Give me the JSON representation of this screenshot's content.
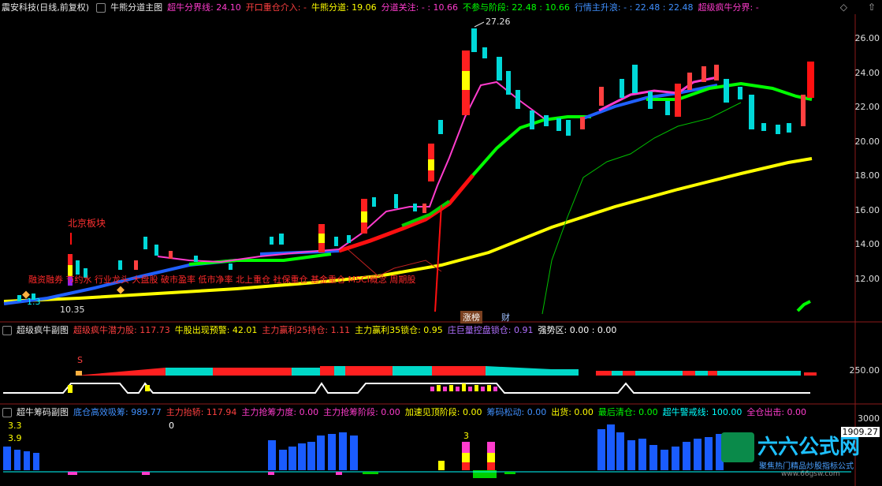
{
  "main": {
    "title": "震安科技(日线,前复权)",
    "indicator": "牛熊分道主图",
    "values": [
      {
        "label": "超牛分界线: 24.10",
        "color": "#ff3ccd"
      },
      {
        "label": "开口重仓介入: -",
        "color": "#ff4040"
      },
      {
        "label": "牛熊分道: 19.06",
        "color": "#ffff00"
      },
      {
        "label": "分道关注: - : 10.66",
        "color": "#ff3ccd"
      },
      {
        "label": "不参与阶段: 22.48 : 10.66",
        "color": "#00ff00"
      },
      {
        "label": "行情主升浪: - : 22.48 : 22.48",
        "color": "#4090ff"
      },
      {
        "label": "超级疯牛分界: -",
        "color": "#ff3ccd"
      }
    ],
    "y_ticks": [
      "26.00",
      "24.00",
      "22.00",
      "20.00",
      "18.00",
      "16.00",
      "14.00",
      "12.00"
    ],
    "annotations": {
      "peak": "27.26",
      "low": "10.35",
      "beijing": "北京板块",
      "concept": "融资融券 节约水 行业龙头 大盘股 破市盈率 低市净率 北上重仓 社保重仓 基金重仓 MSCI概念 周期股",
      "n13": "1.3",
      "zhangbang": "涨榜",
      "cai": "财"
    }
  },
  "sub1": {
    "indicator": "超级疯牛副图",
    "values": [
      {
        "label": "超级疯牛潜力股: 117.73",
        "color": "#ff4040"
      },
      {
        "label": "牛股出现预警: 42.01",
        "color": "#ffff00"
      },
      {
        "label": "主力赢利25持仓: 1.11",
        "color": "#ff4040"
      },
      {
        "label": "主力赢利35锁仓: 0.95",
        "color": "#ffff00"
      },
      {
        "label": "庄巨量控盘锁仓: 0.91",
        "color": "#b070ff"
      },
      {
        "label": "强势区: 0.00 : 0.00",
        "color": "#ffffff"
      }
    ],
    "y_tick": "250.00",
    "s_mark": "S"
  },
  "sub2": {
    "indicator": "超牛筹码副图",
    "values": [
      {
        "label": "底仓高效吸筹: 989.77",
        "color": "#4090ff"
      },
      {
        "label": "主力抬轿: 117.94",
        "color": "#ff4040"
      },
      {
        "label": "主力抢筹力度: 0.00",
        "color": "#ff3ccd"
      },
      {
        "label": "主力抢筹阶段: 0.00",
        "color": "#ff3ccd"
      },
      {
        "label": "加速见顶阶段: 0.00",
        "color": "#ffff00"
      },
      {
        "label": "筹码松动: 0.00",
        "color": "#4090ff"
      },
      {
        "label": "出货: 0.00",
        "color": "#ffff00"
      },
      {
        "label": "最后清仓: 0.00",
        "color": "#00ff00"
      },
      {
        "label": "超牛警戒线: 100.00",
        "color": "#00ffff"
      },
      {
        "label": "全仓出击: 0.00",
        "color": "#ff3ccd"
      }
    ],
    "y_ticks": [
      "3000",
      "1909.27"
    ],
    "left_vals": [
      "3.3",
      "3.9"
    ],
    "zero": "0",
    "three": "3"
  },
  "watermark": {
    "brand": "六六公式网",
    "sub": "聚焦热门精品炒股指标公式",
    "url": "www.66gsw.com"
  },
  "corner_icons": [
    "diamond-icon",
    "arrow-up-icon"
  ]
}
